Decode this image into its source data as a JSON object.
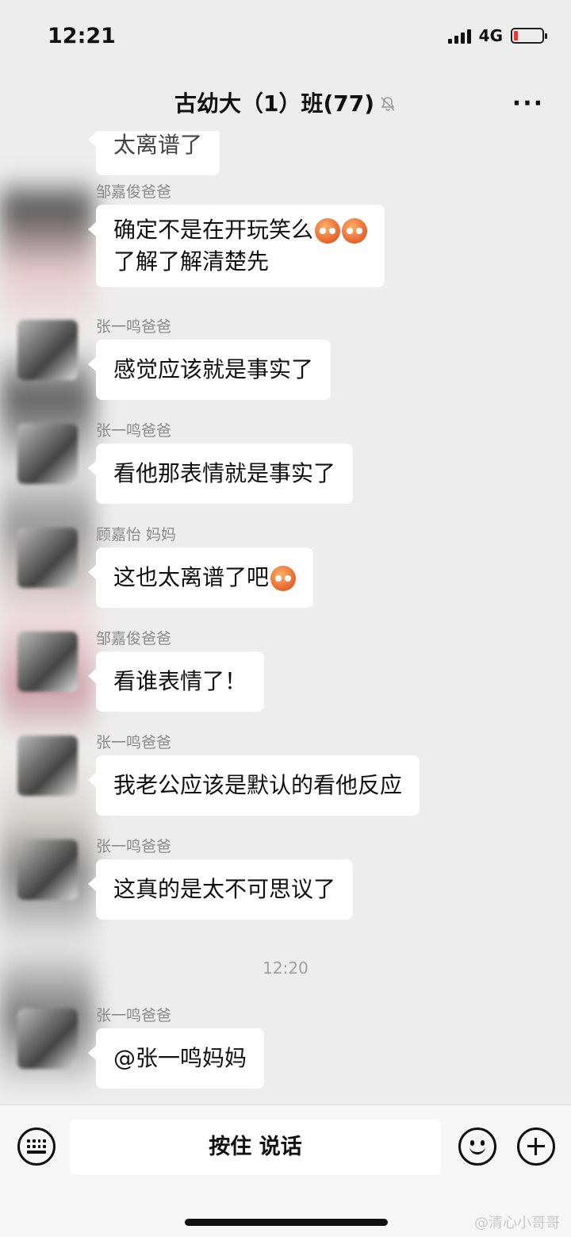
{
  "status_bar": {
    "time": "12:21",
    "network": "4G"
  },
  "header": {
    "title": "古幼大（1）班(77)",
    "mute_icon": "bell-muted-icon",
    "more_label": "···"
  },
  "messages": [
    {
      "sender": "",
      "text": "太离谱了"
    },
    {
      "sender": "邹嘉俊爸爸",
      "line1": "确定不是在开玩笑么",
      "line2": "了解了解清楚先"
    },
    {
      "sender": "张一鸣爸爸",
      "text": "感觉应该就是事实了"
    },
    {
      "sender": "张一鸣爸爸",
      "text": "看他那表情就是事实了"
    },
    {
      "sender": "顾嘉怡 妈妈",
      "text": "这也太离谱了吧"
    },
    {
      "sender": "邹嘉俊爸爸",
      "text": "看谁表情了！"
    },
    {
      "sender": "张一鸣爸爸",
      "text": "我老公应该是默认的看他反应"
    },
    {
      "sender": "张一鸣爸爸",
      "text": "这真的是太不可思议了"
    },
    {
      "sender": "张一鸣爸爸",
      "text": "@张一鸣妈妈"
    }
  ],
  "time_separator": "12:20",
  "input_bar": {
    "hold_to_talk": "按住 说话"
  },
  "watermark": "@清心小哥哥",
  "colors": {
    "bubble": "#ffffff",
    "background": "#ededed",
    "emoji": "#e5632a"
  }
}
